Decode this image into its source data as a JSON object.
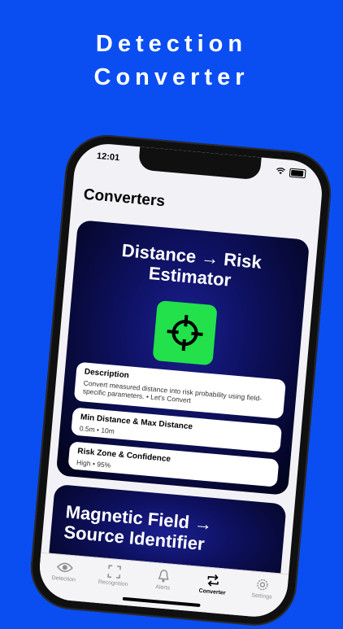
{
  "headline": {
    "line1": "Detection",
    "line2": "Converter"
  },
  "status": {
    "time": "12:01"
  },
  "page": {
    "title": "Converters"
  },
  "cards": [
    {
      "title": "Distance → Risk Estimator",
      "icon": "crosshair-icon",
      "description_label": "Description",
      "description_value": "Convert measured distance into risk probability using field-specific parameters. • Let's Convert",
      "range_label": "Min Distance & Max Distance",
      "range_value": "0.5m • 10m",
      "risk_label": "Risk Zone & Confidence",
      "risk_value": "High • 95%"
    },
    {
      "title": "Magnetic Field → Source Identifier"
    }
  ],
  "tabs": [
    {
      "label": "Detection",
      "icon": "eye-icon"
    },
    {
      "label": "Recognition",
      "icon": "scan-icon"
    },
    {
      "label": "Alerts",
      "icon": "bell-icon"
    },
    {
      "label": "Converter",
      "icon": "convert-arrows-icon"
    },
    {
      "label": "Settings",
      "icon": "gear-icon"
    }
  ],
  "colors": {
    "background": "#0a4ef2",
    "icon_tile": "#22e14a",
    "card": "#0e1160"
  }
}
